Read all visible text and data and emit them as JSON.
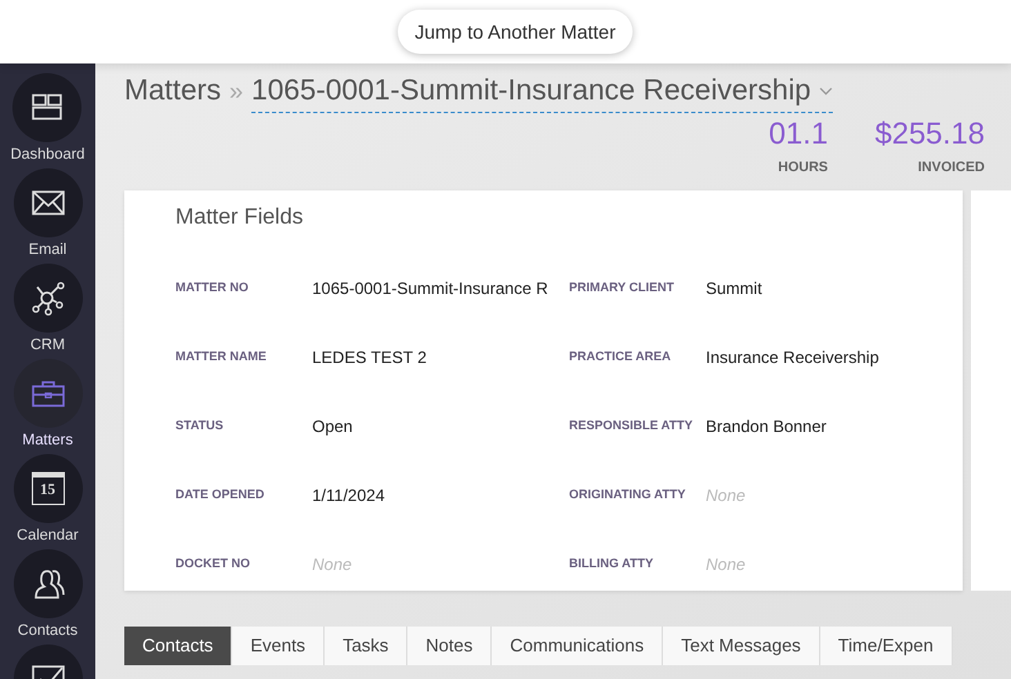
{
  "header": {
    "jump_button": "Jump to Another Matter"
  },
  "sidebar": {
    "items": [
      {
        "label": "Dashboard",
        "selected": false
      },
      {
        "label": "Email",
        "selected": false
      },
      {
        "label": "CRM",
        "selected": false
      },
      {
        "label": "Matters",
        "selected": true
      },
      {
        "label": "Calendar",
        "icon_text": "15",
        "selected": false
      },
      {
        "label": "Contacts",
        "selected": false
      },
      {
        "selected": false
      }
    ]
  },
  "breadcrumb": {
    "root": "Matters",
    "separator": "»",
    "current": "1065-0001-Summit-Insurance Receivership"
  },
  "stats": [
    {
      "value": "01.1",
      "label": "HOURS"
    },
    {
      "value": "$255.18",
      "label": "INVOICED"
    }
  ],
  "matter_fields": {
    "title": "Matter Fields",
    "fields": [
      {
        "label": "MATTER NO",
        "value": "1065-0001-Summit-Insurance R",
        "kind": "text"
      },
      {
        "label": "PRIMARY CLIENT",
        "value": "Summit",
        "kind": "text"
      },
      {
        "label": "MATTER NAME",
        "value": "LEDES TEST 2",
        "kind": "text"
      },
      {
        "label": "PRACTICE AREA",
        "value": "Insurance Receivership",
        "kind": "text"
      },
      {
        "label": "STATUS",
        "value": "Open",
        "kind": "text"
      },
      {
        "label": "RESPONSIBLE ATTY",
        "value": "Brandon Bonner",
        "kind": "text"
      },
      {
        "label": "DATE OPENED",
        "value": "1/11/2024",
        "kind": "text"
      },
      {
        "label": "ORIGINATING ATTY",
        "value": "None",
        "kind": "empty"
      },
      {
        "label": "DOCKET NO",
        "value": "None",
        "kind": "empty"
      },
      {
        "label": "BILLING ATTY",
        "value": "None",
        "kind": "empty"
      }
    ]
  },
  "tabs": [
    {
      "label": "Contacts",
      "selected": true
    },
    {
      "label": "Events",
      "selected": false
    },
    {
      "label": "Tasks",
      "selected": false
    },
    {
      "label": "Notes",
      "selected": false
    },
    {
      "label": "Communications",
      "selected": false
    },
    {
      "label": "Text Messages",
      "selected": false
    },
    {
      "label": "Time/Expen",
      "selected": false
    }
  ]
}
